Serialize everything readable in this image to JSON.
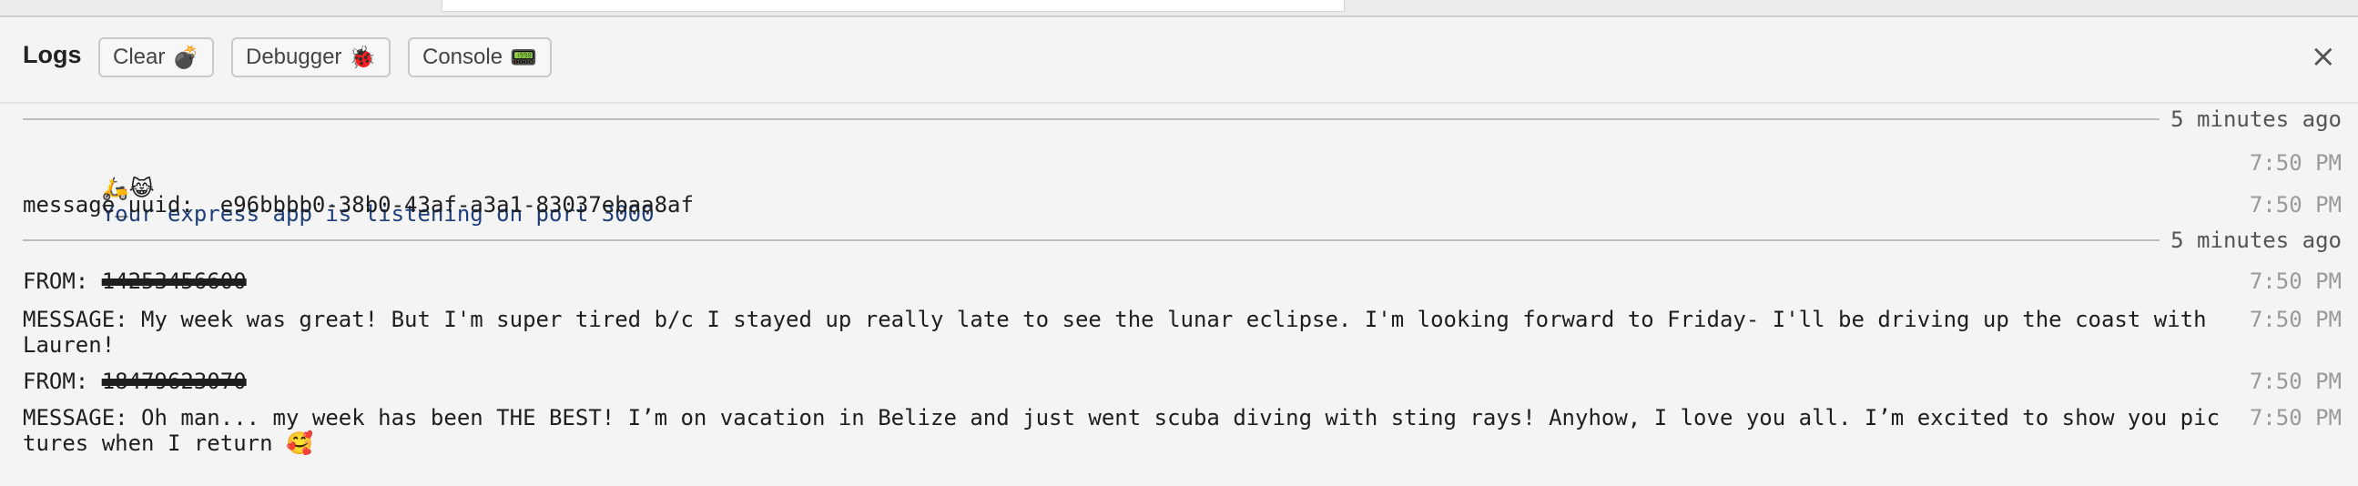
{
  "header": {
    "title": "Logs",
    "clear_label": "Clear",
    "clear_icon": "💣",
    "debugger_label": "Debugger",
    "debugger_icon": "🐞",
    "console_label": "Console",
    "console_icon": "📟",
    "close_glyph": "×"
  },
  "separators": [
    {
      "ago": "5 minutes ago"
    },
    {
      "ago": "5 minutes ago"
    }
  ],
  "logs": [
    {
      "icons": "🛵😹",
      "text": "Your express app is listening on port 3000",
      "time": "7:50 PM"
    },
    {
      "prefix": "message_uuid:  ",
      "text": "e96bbbb0-38b0-43af-a3a1-83037ebaa8af",
      "time": "7:50 PM"
    },
    {
      "prefix": "FROM: ",
      "redacted": "14253456600",
      "time": "7:50 PM"
    },
    {
      "text": "MESSAGE: My week was great! But I'm super tired b/c I stayed up really late to see the lunar eclipse. I'm looking forward to Friday- I'll be driving up the coast with Lauren!",
      "time": "7:50 PM"
    },
    {
      "prefix": "FROM: ",
      "redacted": "18479623070",
      "time": "7:50 PM"
    },
    {
      "text": "MESSAGE: Oh man... my week has been THE BEST! I’m on vacation in Belize and just went scuba diving with sting rays! Anyhow, I love you all. I’m excited to show you pictures when I return ",
      "emoji": "🥰",
      "time": "7:50 PM"
    }
  ]
}
